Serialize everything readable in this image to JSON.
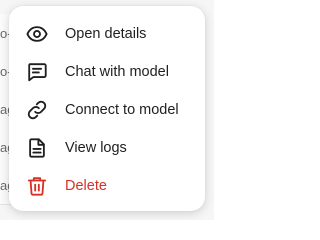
{
  "background_list": {
    "rows": [
      {
        "text": "o-"
      },
      {
        "text": "o-"
      },
      {
        "text": "ag"
      },
      {
        "text": "ag"
      },
      {
        "text": "ag"
      }
    ]
  },
  "menu": {
    "items": [
      {
        "label": "Open details",
        "icon": "eye-icon"
      },
      {
        "label": "Chat with model",
        "icon": "chat-icon"
      },
      {
        "label": "Connect to model",
        "icon": "link-icon"
      },
      {
        "label": "View logs",
        "icon": "document-icon"
      },
      {
        "label": "Delete",
        "icon": "trash-icon"
      }
    ]
  },
  "colors": {
    "text": "#1f1f1f",
    "danger": "#d93025",
    "menu_bg": "#ffffff",
    "page_bg": "#f6f6f7"
  }
}
